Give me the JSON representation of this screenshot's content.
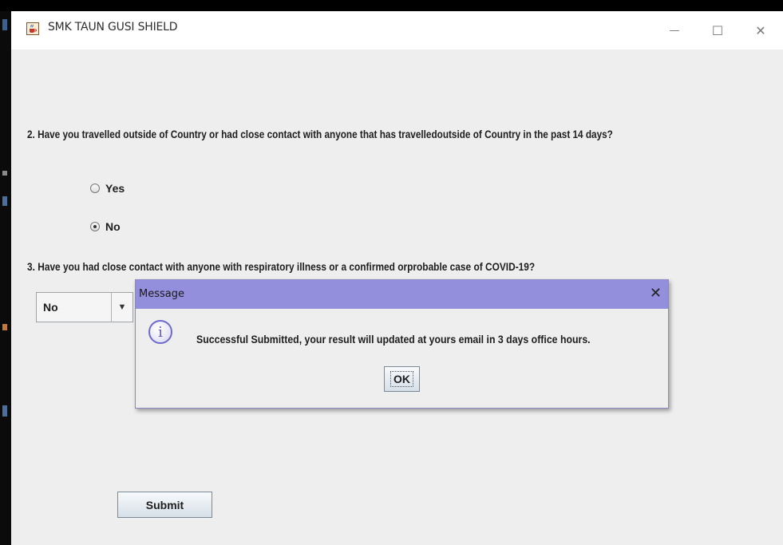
{
  "window": {
    "title": "SMK TAUN GUSI SHIELD",
    "icon": "java-coffee-cup-icon",
    "minimize_glyph": "—",
    "maximize_glyph": "☐",
    "close_glyph": "✕"
  },
  "form": {
    "question2": "2. Have you travelled outside of Country or had close contact with anyone that has travelledoutside of Country in the past 14 days?",
    "options": [
      {
        "label": "Yes",
        "selected": false
      },
      {
        "label": "No",
        "selected": true
      }
    ],
    "question3": "3. Have you had close contact with anyone with respiratory illness or a confirmed orprobable case of COVID-19?",
    "combo_value": "No",
    "combo_arrow": "▼",
    "submit_label": "Submit"
  },
  "dialog": {
    "title": "Message",
    "close_glyph": "✕",
    "icon": "info-icon",
    "icon_glyph": "i",
    "message": "Successful Submitted, your result will updated at yours email in 3 days office hours.",
    "ok_label": "OK"
  },
  "colors": {
    "dialog_title": "#948fdc",
    "window_bg": "#eeeeee",
    "titlebar_bg": "#ffffff"
  }
}
